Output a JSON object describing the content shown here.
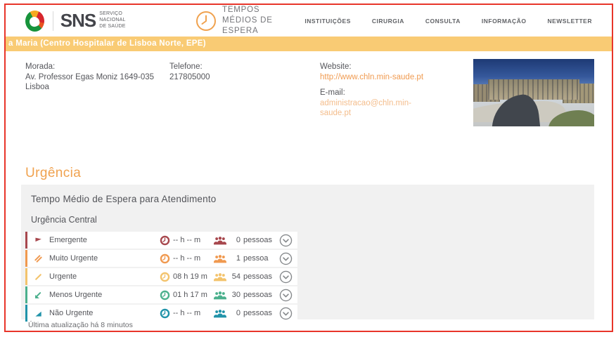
{
  "theme": {
    "frame_red": "#E8352A",
    "banner_bg": "#F9CB74",
    "accent_orange": "#F0A24F",
    "link_orange": "#F09B51",
    "link_light_orange": "#F4BD8C",
    "nav_grey": "#606266",
    "text_grey": "#54555A",
    "panel_grey": "#F1F1F1",
    "chevron_grey": "#85888B"
  },
  "header": {
    "logo": {
      "sns": "SNS",
      "tagline_line1": "SERVIÇO NACIONAL",
      "tagline_line2": "DE SAÚDE"
    },
    "site_title_line1": "TEMPOS",
    "site_title_line2": "MÉDIOS DE ESPERA",
    "nav": [
      {
        "label": "INSTITUIÇÕES"
      },
      {
        "label": "CIRURGIA"
      },
      {
        "label": "CONSULTA"
      },
      {
        "label": "INFORMAÇÃO"
      },
      {
        "label": "NEWSLETTER"
      }
    ]
  },
  "banner": {
    "hospital_name": "a Maria (Centro Hospitalar de Lisboa Norte, EPE)"
  },
  "contact": {
    "morada_label": "Morada:",
    "morada_value": "Av. Professor Egas Moniz 1649-035 Lisboa",
    "telefone_label": "Telefone:",
    "telefone_value": "217805000",
    "website_label": "Website:",
    "website_value": "http://www.chln.min-saude.pt",
    "email_label": "E-mail:",
    "email_value": "administracao@chln.min-saude.pt"
  },
  "urgencia": {
    "section_title": "Urgência",
    "panel_title": "Tempo Médio de Espera para Atendimento",
    "subsection": "Urgência Central",
    "rows": [
      {
        "label": "Emergente",
        "time": "-- h -- m",
        "count": "0",
        "unit": "pessoas",
        "color": "#A7474D"
      },
      {
        "label": "Muito Urgente",
        "time": "-- h -- m",
        "count": "1",
        "unit": "pessoa",
        "color": "#F0994F"
      },
      {
        "label": "Urgente",
        "time": "08 h 19 m",
        "count": "54",
        "unit": "pessoas",
        "color": "#F3C36C"
      },
      {
        "label": "Menos Urgente",
        "time": "01 h 17 m",
        "count": "30",
        "unit": "pessoas",
        "color": "#4BB08D"
      },
      {
        "label": "Não Urgente",
        "time": "-- h -- m",
        "count": "0",
        "unit": "pessoas",
        "color": "#2093A9"
      }
    ],
    "last_update": "Última atualização há 8 minutos"
  },
  "icons": {
    "sns_globe": "sns-globe-icon",
    "clock": "clock-icon",
    "people": "people-icon",
    "chevron": "chevron-down-icon",
    "row_0": "flag-icon",
    "row_1": "double-slash-icon",
    "row_2": "single-slash-icon",
    "row_3": "slash-triangle-icon",
    "row_4": "triangle-icon"
  }
}
